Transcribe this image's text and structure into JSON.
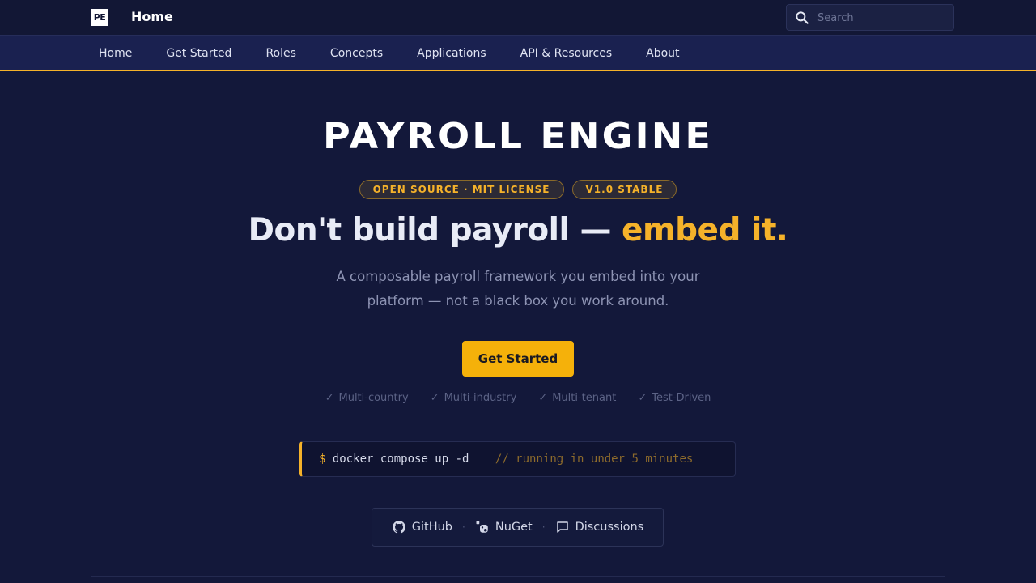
{
  "header": {
    "logo_text": "PE",
    "title": "Home",
    "search": {
      "placeholder": "Search",
      "value": ""
    }
  },
  "tabs": [
    {
      "label": "Home"
    },
    {
      "label": "Get Started"
    },
    {
      "label": "Roles"
    },
    {
      "label": "Concepts"
    },
    {
      "label": "Applications"
    },
    {
      "label": "API & Resources"
    },
    {
      "label": "About"
    }
  ],
  "hero": {
    "brand": "PAYROLL ENGINE",
    "badges": [
      "OPEN SOURCE · MIT LICENSE",
      "V1.0 STABLE"
    ],
    "headline_main": "Don't build payroll — ",
    "headline_accent": "embed it.",
    "subtitle": "A composable payroll framework you embed into your platform — not a black box you work around.",
    "cta_label": "Get Started",
    "features": [
      "Multi-country",
      "Multi-industry",
      "Multi-tenant",
      "Test-Driven"
    ],
    "check_glyph": "✓",
    "code": {
      "prompt": "$",
      "command": "docker compose up -d",
      "comment": "// running in under 5 minutes"
    },
    "links": [
      {
        "label": "GitHub",
        "icon": "github-icon"
      },
      {
        "label": "NuGet",
        "icon": "nuget-icon"
      },
      {
        "label": "Discussions",
        "icon": "chat-bubble-icon"
      }
    ],
    "link_separator": "·"
  },
  "colors": {
    "background": "#13183a",
    "accent": "#f5b22a",
    "tab_bar": "#1a2150"
  }
}
